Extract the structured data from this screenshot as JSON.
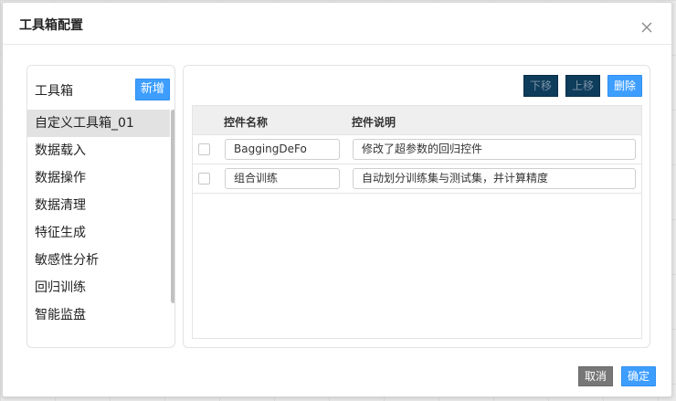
{
  "dialog": {
    "title": "工具箱配置",
    "close_icon": "close-icon"
  },
  "toolbox": {
    "title": "工具箱",
    "add_label": "新增",
    "selected_index": 0,
    "items": [
      {
        "label": "自定义工具箱_01"
      },
      {
        "label": "数据载入"
      },
      {
        "label": "数据操作"
      },
      {
        "label": "数据清理"
      },
      {
        "label": "特征生成"
      },
      {
        "label": "敏感性分析"
      },
      {
        "label": "回归训练"
      },
      {
        "label": "智能监盘"
      }
    ]
  },
  "controls": {
    "down_label": "下移",
    "up_label": "上移",
    "delete_label": "删除",
    "columns": {
      "name": "控件名称",
      "description": "控件说明"
    },
    "rows": [
      {
        "checked": false,
        "name": "BaggingDeFo",
        "description": "修改了超参数的回归控件"
      },
      {
        "checked": false,
        "name": "组合训练",
        "description": "自动划分训练集与测试集，并计算精度"
      }
    ]
  },
  "footer": {
    "cancel_label": "取消",
    "ok_label": "确定"
  },
  "colors": {
    "primary": "#3d9eff",
    "dark_button": "#0e3c5b",
    "cancel_button": "#777777",
    "selected_item": "#e2e2e2"
  }
}
